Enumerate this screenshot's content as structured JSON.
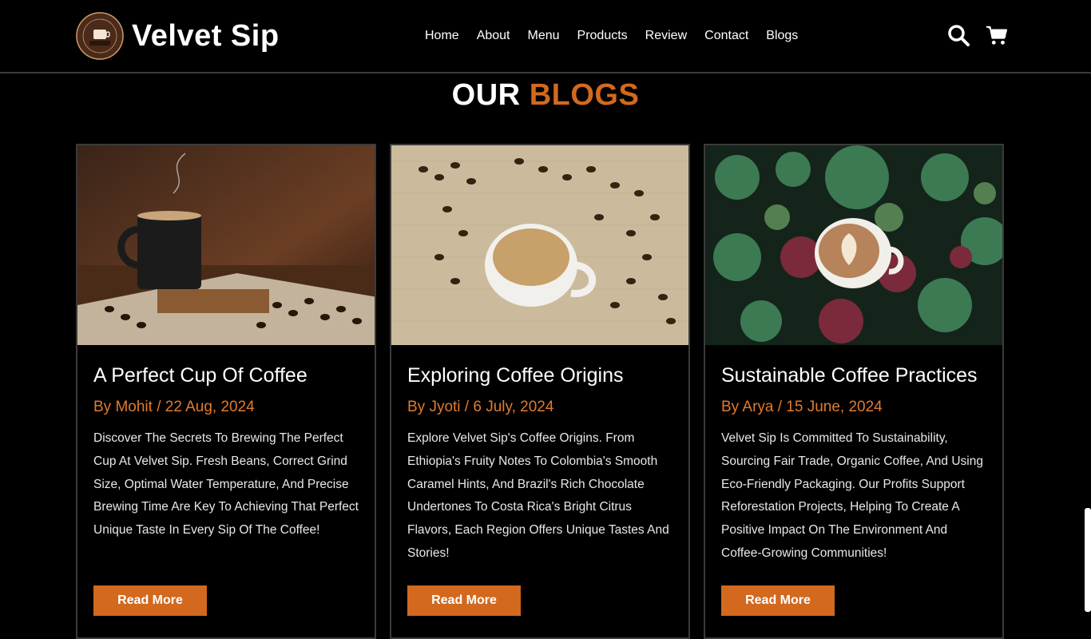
{
  "brand": {
    "name": "Velvet Sip",
    "badge_text": "IT'S COFFEE TIME VELVET SIP CAFE"
  },
  "nav": [
    "Home",
    "About",
    "Menu",
    "Products",
    "Review",
    "Contact",
    "Blogs"
  ],
  "icons": [
    "search-icon",
    "cart-icon"
  ],
  "section": {
    "title_part1": "OUR",
    "title_part2": "BLOGS"
  },
  "colors": {
    "accent": "#d2691e",
    "background": "#000000",
    "meta": "#e07b2e"
  },
  "blogs": [
    {
      "title": "A Perfect Cup Of Coffee",
      "meta": "By Mohit / 22 Aug, 2024",
      "description": "Discover The Secrets To Brewing The Perfect Cup At Velvet Sip. Fresh Beans, Correct Grind Size, Optimal Water Temperature, And Precise Brewing Time Are Key To Achieving That Perfect Unique Taste In Every Sip Of The Coffee!",
      "button": "Read More"
    },
    {
      "title": "Exploring Coffee Origins",
      "meta": "By Jyoti / 6 July, 2024",
      "description": "Explore Velvet Sip's Coffee Origins. From Ethiopia's Fruity Notes To Colombia's Smooth Caramel Hints, And Brazil's Rich Chocolate Undertones To Costa Rica's Bright Citrus Flavors, Each Region Offers Unique Tastes And Stories!",
      "button": "Read More"
    },
    {
      "title": "Sustainable Coffee Practices",
      "meta": "By Arya / 15 June, 2024",
      "description": "Velvet Sip Is Committed To Sustainability, Sourcing Fair Trade, Organic Coffee, And Using Eco-Friendly Packaging. Our Profits Support Reforestation Projects, Helping To Create A Positive Impact On The Environment And Coffee-Growing Communities!",
      "button": "Read More"
    }
  ]
}
